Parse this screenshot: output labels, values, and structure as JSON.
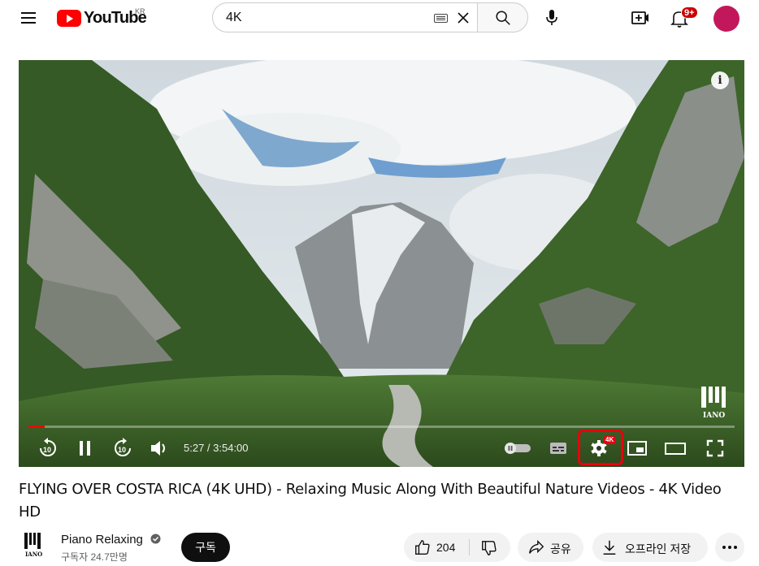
{
  "header": {
    "logo_text": "YouTube",
    "region": "KR",
    "search_value": "4K",
    "notification_count": "9+",
    "avatar_color": "#c2185b"
  },
  "player": {
    "time_display": "5:27 / 3:54:00",
    "progress": 0.023,
    "quality_badge": "4K",
    "info_label": "i",
    "accent_color": "#ff0000",
    "controls": [
      "rewind-10-icon",
      "pause-icon",
      "forward-10-icon",
      "volume-icon",
      "autoplay-toggle",
      "subtitles-icon",
      "settings-icon",
      "miniplayer-icon",
      "theater-icon",
      "fullscreen-icon"
    ]
  },
  "video": {
    "title": "FLYING OVER COSTA RICA (4K UHD) - Relaxing Music Along With Beautiful Nature Videos - 4K Video HD"
  },
  "channel": {
    "name": "Piano Relaxing",
    "subscribers": "구독자 24.7만명",
    "subscribe_label": "구독"
  },
  "actions": {
    "like_count": "204",
    "share_label": "공유",
    "download_label": "오프라인 저장"
  }
}
